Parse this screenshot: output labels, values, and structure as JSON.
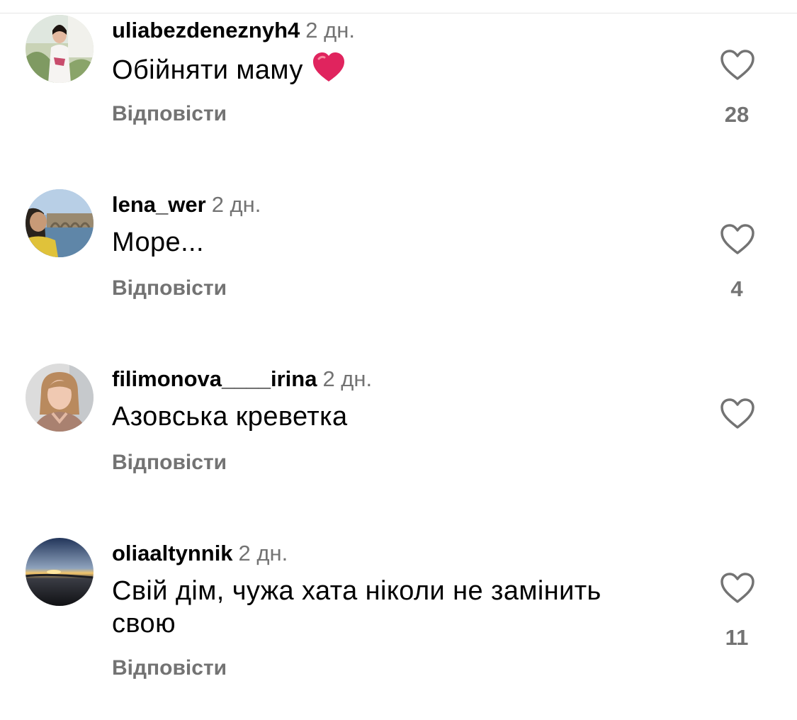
{
  "comments": [
    {
      "username": "uliabezdeneznyh4",
      "time": "2 дн.",
      "text": "Обійняти маму",
      "emoji": "heart-emoji",
      "reply_label": "Відповісти",
      "likes": "28"
    },
    {
      "username": "lena_wer",
      "time": "2 дн.",
      "text": "Море...",
      "reply_label": "Відповісти",
      "likes": "4"
    },
    {
      "username": "filimonova____irina",
      "time": "2 дн.",
      "text": "Азовська креветка",
      "reply_label": "Відповісти",
      "likes": ""
    },
    {
      "username": "oliaaltynnik",
      "time": "2 дн.",
      "text": "Свій дім, чужа хата ніколи не замінить свою",
      "reply_label": "Відповісти",
      "likes": "11"
    }
  ],
  "colors": {
    "text": "#000000",
    "secondary": "#737373",
    "emoji_heart": "#e0245e",
    "divider": "#e6e6e6"
  }
}
